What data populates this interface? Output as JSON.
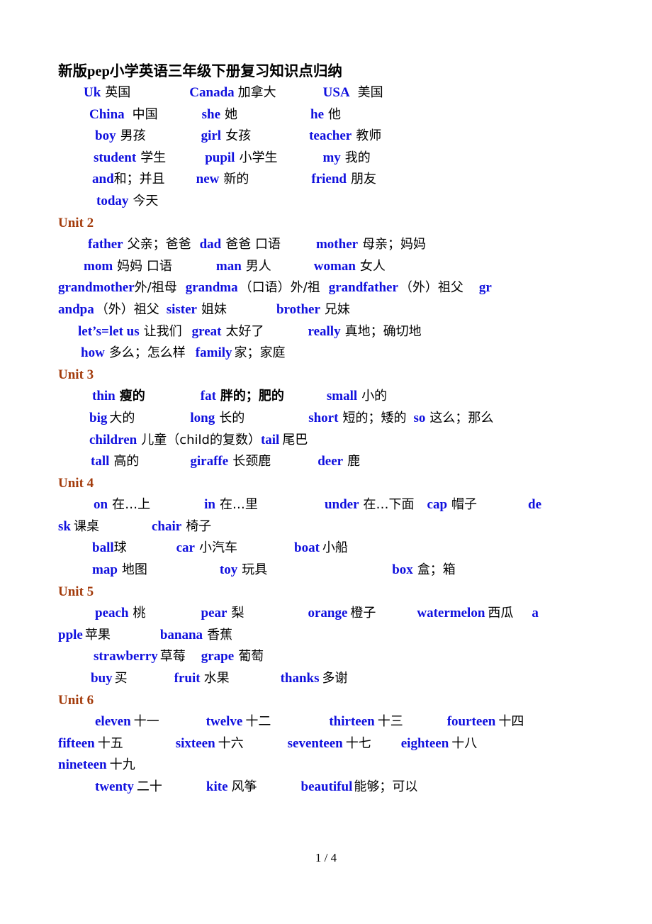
{
  "document": {
    "title": "新版pep小学英语三年级下册复习知识点归纳",
    "footer": "1 / 4",
    "colors": {
      "english_word": "#1010DE",
      "chinese_gloss": "#000000",
      "unit_heading": "#A33B0B",
      "page_background": "#FFFFFF"
    }
  },
  "sections": [
    {
      "heading": null,
      "lines": [
        [
          {
            "indent": 36,
            "en": "Uk",
            "gap": 6,
            "cn": "英国"
          },
          {
            "indent": 83,
            "en": "Canada",
            "gap": 5,
            "cn": "加拿大"
          },
          {
            "indent": 66,
            "en": "USA",
            "gap": 11,
            "cn": "美国"
          }
        ],
        [
          {
            "indent": 44,
            "en": "China",
            "gap": 11,
            "cn": "中国"
          },
          {
            "indent": 62,
            "en": "she",
            "gap": 6,
            "cn": "她"
          },
          {
            "indent": 103,
            "en": "he",
            "gap": 6,
            "cn": "他"
          }
        ],
        [
          {
            "indent": 52,
            "en": "boy",
            "gap": 6,
            "cn": "男孩"
          },
          {
            "indent": 78,
            "en": "girl",
            "gap": 6,
            "cn": "女孩"
          },
          {
            "indent": 82,
            "en": "teacher",
            "gap": 6,
            "cn": "教师"
          }
        ],
        [
          {
            "indent": 50,
            "en": "student",
            "gap": 6,
            "cn": "学生"
          },
          {
            "indent": 55,
            "en": "pupil",
            "gap": 6,
            "cn": "小学生"
          },
          {
            "indent": 64,
            "en": "my",
            "gap": 6,
            "cn": "我的"
          }
        ],
        [
          {
            "indent": 48,
            "en": "and",
            "gap": 0,
            "cn": "和；并且"
          },
          {
            "indent": 44,
            "en": "new",
            "gap": 6,
            "cn": "新的"
          },
          {
            "indent": 88,
            "en": "friend",
            "gap": 6,
            "cn": "朋友"
          }
        ],
        [
          {
            "indent": 54,
            "en": "today",
            "gap": 6,
            "cn": "今天"
          }
        ]
      ]
    },
    {
      "heading": "Unit 2",
      "lines": [
        [
          {
            "indent": 42,
            "en": "father",
            "gap": 6,
            "cn": "父亲；爸爸"
          },
          {
            "indent": 12,
            "en": "dad",
            "gap": 6,
            "cn": "爸爸 口语"
          },
          {
            "indent": 50,
            "en": "mother",
            "gap": 6,
            "cn": "母亲；妈妈"
          }
        ],
        [
          {
            "indent": 36,
            "en": "mom",
            "gap": 6,
            "cn": "妈妈 口语"
          },
          {
            "indent": 62,
            "en": "man",
            "gap": 6,
            "cn": "男人"
          },
          {
            "indent": 60,
            "en": "woman",
            "gap": 6,
            "cn": "女人"
          }
        ],
        [
          {
            "indent": 0,
            "en": "grandmother",
            "gap": 0,
            "cn": "外/祖母"
          },
          {
            "indent": 12,
            "en": "grandma",
            "gap": 2,
            "cn": "（口语）外/祖"
          },
          {
            "indent": 12,
            "en": "grandfather",
            "gap": 2,
            "cn": "（外）祖父"
          },
          {
            "indent": 22,
            "en": "gr",
            "gap": 0,
            "cn": ""
          }
        ],
        [
          {
            "indent": 0,
            "en": "andpa",
            "gap": 2,
            "cn": "（外）祖父"
          },
          {
            "indent": 10,
            "en": "sister",
            "gap": 6,
            "cn": "姐妹"
          },
          {
            "indent": 70,
            "en": "brother",
            "gap": 6,
            "cn": "兄妹"
          }
        ],
        [
          {
            "indent": 28,
            "en": "let’s=let us",
            "gap": 6,
            "cn": "让我们"
          },
          {
            "indent": 14,
            "en": "great",
            "gap": 6,
            "cn": "太好了"
          },
          {
            "indent": 62,
            "en": "really",
            "gap": 6,
            "cn": "真地；确切地"
          }
        ],
        [
          {
            "indent": 32,
            "en": "how",
            "gap": 6,
            "cn": "多么；怎么样"
          },
          {
            "indent": 14,
            "en": "family",
            "gap": 3,
            "cn": "家；家庭"
          }
        ]
      ]
    },
    {
      "heading": "Unit 3",
      "lines": [
        [
          {
            "indent": 48,
            "en": "thin",
            "gap": 6,
            "cn": "瘦的",
            "cn_bold": true
          },
          {
            "indent": 78,
            "en": "fat",
            "gap": 6,
            "cn": "胖的；肥的",
            "cn_bold": true
          },
          {
            "indent": 60,
            "en": "small",
            "gap": 6,
            "cn": "小的"
          }
        ],
        [
          {
            "indent": 44,
            "en": "big",
            "gap": 3,
            "cn": "大的"
          },
          {
            "indent": 78,
            "en": "long",
            "gap": 6,
            "cn": "长的"
          },
          {
            "indent": 90,
            "en": "short",
            "gap": 6,
            "cn": "短的；矮的"
          },
          {
            "indent": 10,
            "en": "so",
            "gap": 6,
            "cn": "这么；那么"
          }
        ],
        [
          {
            "indent": 44,
            "en": "children",
            "gap": 6,
            "cn": "儿童（child的复数）"
          },
          {
            "indent": 0,
            "en": "tail",
            "gap": 4,
            "cn": "尾巴"
          }
        ],
        [
          {
            "indent": 46,
            "en": "tall",
            "gap": 6,
            "cn": "高的"
          },
          {
            "indent": 72,
            "en": "giraffe",
            "gap": 6,
            "cn": "长颈鹿"
          },
          {
            "indent": 66,
            "en": "deer",
            "gap": 6,
            "cn": "鹿"
          }
        ]
      ]
    },
    {
      "heading": "Unit 4",
      "lines": [
        [
          {
            "indent": 50,
            "en": "on",
            "gap": 6,
            "cn": "在…上"
          },
          {
            "indent": 76,
            "en": "in",
            "gap": 6,
            "cn": "在…里"
          },
          {
            "indent": 94,
            "en": "under",
            "gap": 6,
            "cn": "在…下面"
          },
          {
            "indent": 18,
            "en": "cap",
            "gap": 6,
            "cn": "帽子"
          },
          {
            "indent": 72,
            "en": "de",
            "gap": 0,
            "cn": ""
          }
        ],
        [
          {
            "indent": 0,
            "en": "sk",
            "gap": 4,
            "cn": "课桌"
          },
          {
            "indent": 74,
            "en": "chair",
            "gap": 6,
            "cn": "椅子"
          }
        ],
        [
          {
            "indent": 48,
            "en": "ball",
            "gap": 0,
            "cn": "球"
          },
          {
            "indent": 70,
            "en": "car",
            "gap": 6,
            "cn": "小汽车"
          },
          {
            "indent": 80,
            "en": "boat",
            "gap": 4,
            "cn": "小船"
          }
        ],
        [
          {
            "indent": 48,
            "en": "map",
            "gap": 6,
            "cn": "地图"
          },
          {
            "indent": 102,
            "en": "toy",
            "gap": 6,
            "cn": "玩具"
          },
          {
            "indent": 176,
            "en": "box",
            "gap": 6,
            "cn": "盒；箱"
          }
        ]
      ]
    },
    {
      "heading": "Unit 5",
      "lines": [
        [
          {
            "indent": 52,
            "en": "peach",
            "gap": 6,
            "cn": "桃"
          },
          {
            "indent": 78,
            "en": "pear",
            "gap": 6,
            "cn": "梨"
          },
          {
            "indent": 90,
            "en": "orange",
            "gap": 4,
            "cn": "橙子"
          },
          {
            "indent": 58,
            "en": "watermelon",
            "gap": 4,
            "cn": "西瓜"
          },
          {
            "indent": 26,
            "en": "a",
            "gap": 0,
            "cn": ""
          }
        ],
        [
          {
            "indent": 0,
            "en": "pple",
            "gap": 3,
            "cn": "苹果"
          },
          {
            "indent": 70,
            "en": "banana",
            "gap": 6,
            "cn": "香蕉"
          }
        ],
        [
          {
            "indent": 50,
            "en": "strawberry",
            "gap": 3,
            "cn": "草莓"
          },
          {
            "indent": 22,
            "en": "grape",
            "gap": 6,
            "cn": "葡萄"
          }
        ],
        [
          {
            "indent": 46,
            "en": "buy",
            "gap": 3,
            "cn": "买"
          },
          {
            "indent": 66,
            "en": "fruit",
            "gap": 5,
            "cn": "水果"
          },
          {
            "indent": 72,
            "en": "thanks",
            "gap": 4,
            "cn": "多谢"
          }
        ]
      ]
    },
    {
      "heading": "Unit 6",
      "lines": [
        [
          {
            "indent": 52,
            "en": "eleven",
            "gap": 4,
            "cn": "十一"
          },
          {
            "indent": 66,
            "en": "twelve",
            "gap": 4,
            "cn": "十二"
          },
          {
            "indent": 82,
            "en": "thirteen",
            "gap": 4,
            "cn": "十三"
          },
          {
            "indent": 62,
            "en": "fourteen",
            "gap": 4,
            "cn": "十四"
          }
        ],
        [
          {
            "indent": 0,
            "en": "fifteen",
            "gap": 4,
            "cn": "十五"
          },
          {
            "indent": 74,
            "en": "sixteen",
            "gap": 4,
            "cn": "十六"
          },
          {
            "indent": 62,
            "en": "seventeen",
            "gap": 4,
            "cn": "十七"
          },
          {
            "indent": 42,
            "en": "eighteen",
            "gap": 4,
            "cn": "十八"
          }
        ],
        [
          {
            "indent": 0,
            "en": "nineteen",
            "gap": 4,
            "cn": "十九"
          }
        ],
        [
          {
            "indent": 52,
            "en": "twenty",
            "gap": 4,
            "cn": "二十"
          },
          {
            "indent": 62,
            "en": "kite",
            "gap": 5,
            "cn": "风筝"
          },
          {
            "indent": 62,
            "en": "beautiful",
            "gap": 2,
            "cn": "能够；可以"
          }
        ]
      ]
    }
  ]
}
